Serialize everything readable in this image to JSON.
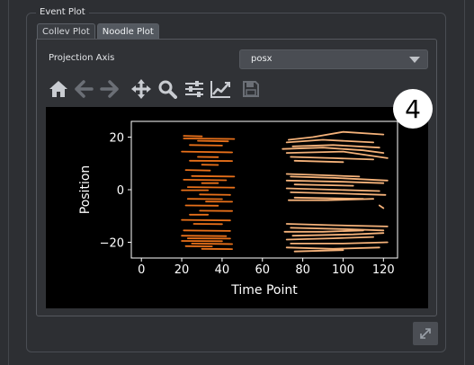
{
  "group": {
    "title": "Event Plot"
  },
  "tabs": [
    {
      "label": "Collev Plot",
      "active": false
    },
    {
      "label": "Noodle Plot",
      "active": true
    }
  ],
  "projection": {
    "label": "Projection Axis",
    "value": "posx"
  },
  "toolbar": {
    "icons": [
      "home-icon",
      "back-arrow-icon",
      "forward-arrow-icon",
      "pan-icon",
      "zoom-icon",
      "configure-subplots-icon",
      "edit-axis-icon",
      "save-icon"
    ]
  },
  "badge": {
    "text": "4"
  },
  "colors": {
    "dark_orange": "#e8701a",
    "light_orange": "#f5b27a",
    "plot_bg": "#000000"
  },
  "chart_data": {
    "type": "line",
    "xlabel": "Time Point",
    "ylabel": "Position",
    "xticks": [
      "0",
      "20",
      "40",
      "60",
      "80",
      "100",
      "120"
    ],
    "yticks": [
      "−20",
      "0",
      "20"
    ],
    "xlim": [
      -5,
      127
    ],
    "ylim": [
      -26,
      26
    ],
    "series": [
      {
        "color": "dark",
        "x": [
          21,
          30
        ],
        "y": [
          20.5,
          20.3
        ]
      },
      {
        "color": "dark",
        "x": [
          21,
          46
        ],
        "y": [
          19.5,
          19.3
        ]
      },
      {
        "color": "dark",
        "x": [
          28,
          43
        ],
        "y": [
          18.6,
          18.4
        ]
      },
      {
        "color": "dark",
        "x": [
          24,
          40
        ],
        "y": [
          17.0,
          16.8
        ]
      },
      {
        "color": "dark",
        "x": [
          20,
          45
        ],
        "y": [
          14.5,
          14.2
        ]
      },
      {
        "color": "dark",
        "x": [
          28,
          38
        ],
        "y": [
          12.5,
          12.4
        ]
      },
      {
        "color": "dark",
        "x": [
          24,
          45
        ],
        "y": [
          11.0,
          10.9
        ]
      },
      {
        "color": "dark",
        "x": [
          30,
          38
        ],
        "y": [
          9.5,
          9.4
        ]
      },
      {
        "color": "dark",
        "x": [
          22,
          34
        ],
        "y": [
          7.5,
          7.3
        ]
      },
      {
        "color": "dark",
        "x": [
          25,
          46
        ],
        "y": [
          5.2,
          5.0
        ]
      },
      {
        "color": "dark",
        "x": [
          21,
          42
        ],
        "y": [
          3.8,
          3.6
        ]
      },
      {
        "color": "dark",
        "x": [
          30,
          38
        ],
        "y": [
          2.5,
          2.5
        ]
      },
      {
        "color": "dark",
        "x": [
          23,
          46
        ],
        "y": [
          1.0,
          0.8
        ]
      },
      {
        "color": "dark",
        "x": [
          20,
          33
        ],
        "y": [
          -0.2,
          -0.2
        ]
      },
      {
        "color": "dark",
        "x": [
          29,
          44
        ],
        "y": [
          -1.8,
          -2.0
        ]
      },
      {
        "color": "dark",
        "x": [
          23,
          40
        ],
        "y": [
          -3.5,
          -3.6
        ]
      },
      {
        "color": "dark",
        "x": [
          32,
          45
        ],
        "y": [
          -4.5,
          -4.6
        ]
      },
      {
        "color": "dark",
        "x": [
          22,
          38
        ],
        "y": [
          -6.0,
          -6.1
        ]
      },
      {
        "color": "dark",
        "x": [
          29,
          45
        ],
        "y": [
          -8.0,
          -8.1
        ]
      },
      {
        "color": "dark",
        "x": [
          24,
          33
        ],
        "y": [
          -9.5,
          -9.5
        ]
      },
      {
        "color": "dark",
        "x": [
          20,
          44
        ],
        "y": [
          -11.5,
          -11.7
        ]
      },
      {
        "color": "dark",
        "x": [
          26,
          40
        ],
        "y": [
          -13.0,
          -13.1
        ]
      },
      {
        "color": "dark",
        "x": [
          21,
          44
        ],
        "y": [
          -15.5,
          -15.7
        ]
      },
      {
        "color": "dark",
        "x": [
          20,
          42
        ],
        "y": [
          -17.5,
          -17.7
        ]
      },
      {
        "color": "dark",
        "x": [
          23,
          44
        ],
        "y": [
          -18.5,
          -18.6
        ]
      },
      {
        "color": "dark",
        "x": [
          20,
          40
        ],
        "y": [
          -19.5,
          -19.6
        ]
      },
      {
        "color": "dark",
        "x": [
          25,
          45
        ],
        "y": [
          -20.5,
          -20.7
        ]
      },
      {
        "color": "dark",
        "x": [
          22,
          35
        ],
        "y": [
          -21.5,
          -21.6
        ]
      },
      {
        "color": "dark",
        "x": [
          30,
          45
        ],
        "y": [
          -22.5,
          -22.6
        ]
      },
      {
        "color": "light",
        "x": [
          73,
          85,
          100,
          120
        ],
        "y": [
          19.0,
          20.0,
          22.0,
          21.0
        ]
      },
      {
        "color": "light",
        "x": [
          72,
          90,
          115
        ],
        "y": [
          18.0,
          19.0,
          18.0
        ]
      },
      {
        "color": "light",
        "x": [
          75,
          95,
          118
        ],
        "y": [
          16.5,
          17.0,
          16.0
        ]
      },
      {
        "color": "light",
        "x": [
          70,
          90,
          110,
          120
        ],
        "y": [
          15.5,
          16.0,
          15.0,
          14.0
        ]
      },
      {
        "color": "light",
        "x": [
          72,
          100,
          122
        ],
        "y": [
          14.0,
          14.5,
          12.0
        ]
      },
      {
        "color": "light",
        "x": [
          74,
          95,
          115
        ],
        "y": [
          12.5,
          12.0,
          11.5
        ]
      },
      {
        "color": "light",
        "x": [
          76,
          100
        ],
        "y": [
          11.0,
          10.5
        ]
      },
      {
        "color": "light",
        "x": [
          72,
          90,
          108
        ],
        "y": [
          6.0,
          5.5,
          5.0
        ]
      },
      {
        "color": "light",
        "x": [
          74,
          95,
          122
        ],
        "y": [
          5.0,
          4.5,
          3.5
        ]
      },
      {
        "color": "light",
        "x": [
          72,
          100,
          120
        ],
        "y": [
          3.5,
          3.0,
          2.5
        ]
      },
      {
        "color": "light",
        "x": [
          76,
          105
        ],
        "y": [
          2.0,
          1.5
        ]
      },
      {
        "color": "light",
        "x": [
          72,
          95,
          118
        ],
        "y": [
          0.5,
          0.0,
          -0.5
        ]
      },
      {
        "color": "light",
        "x": [
          74,
          100,
          121
        ],
        "y": [
          -1.0,
          -1.5,
          -2.0
        ]
      },
      {
        "color": "light",
        "x": [
          76,
          110
        ],
        "y": [
          -3.0,
          -3.5
        ]
      },
      {
        "color": "light",
        "x": [
          73,
          92,
          115
        ],
        "y": [
          -4.0,
          -4.0,
          -3.5
        ]
      },
      {
        "color": "light",
        "x": [
          118,
          120
        ],
        "y": [
          -6.0,
          -7.0
        ]
      },
      {
        "color": "light",
        "x": [
          72,
          95,
          122
        ],
        "y": [
          -13.0,
          -13.5,
          -14.0
        ]
      },
      {
        "color": "light",
        "x": [
          74,
          100,
          120
        ],
        "y": [
          -14.5,
          -15.0,
          -15.5
        ]
      },
      {
        "color": "light",
        "x": [
          71,
          90,
          110
        ],
        "y": [
          -16.0,
          -16.0,
          -15.5
        ]
      },
      {
        "color": "light",
        "x": [
          75,
          105,
          120
        ],
        "y": [
          -17.5,
          -17.0,
          -16.5
        ]
      },
      {
        "color": "light",
        "x": [
          72,
          95,
          115
        ],
        "y": [
          -19.0,
          -18.5,
          -18.0
        ]
      },
      {
        "color": "light",
        "x": [
          74,
          100,
          122
        ],
        "y": [
          -20.5,
          -20.5,
          -20.0
        ]
      },
      {
        "color": "light",
        "x": [
          72,
          95,
          118
        ],
        "y": [
          -22.0,
          -22.5,
          -22.0
        ]
      },
      {
        "color": "light",
        "x": [
          76,
          100
        ],
        "y": [
          -23.5,
          -23.0
        ]
      }
    ]
  }
}
